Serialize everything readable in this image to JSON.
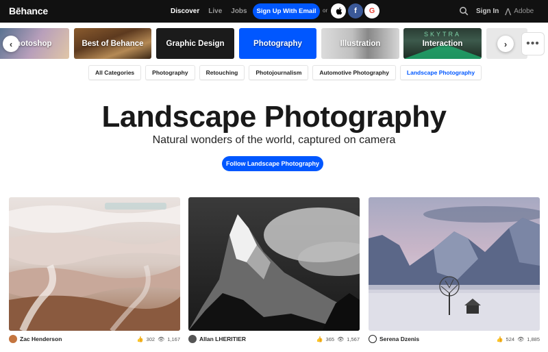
{
  "nav": {
    "logo": "Bēhance",
    "links": [
      "Discover",
      "Live",
      "Jobs"
    ],
    "signup_label": "Sign Up With Email",
    "or_label": "or",
    "social": [
      "apple",
      "f",
      "G"
    ],
    "signin_label": "Sign In",
    "adobe_label": "Adobe"
  },
  "categories": [
    "Photoshop",
    "Best of Behance",
    "Graphic Design",
    "Photography",
    "Illustration",
    "Interaction"
  ],
  "interaction_brand": "SKYTRA",
  "filters": [
    "All Categories",
    "Photography",
    "Retouching",
    "Photojournalism",
    "Automotive Photography",
    "Landscape Photography"
  ],
  "active_filter": "Landscape Photography",
  "hero": {
    "title": "Landscape Photography",
    "subtitle": "Natural wonders of the world, captured on camera",
    "follow_label": "Follow Landscape Photography"
  },
  "projects": [
    {
      "owner": "Zac Henderson",
      "appreciations": "302",
      "views": "1,167"
    },
    {
      "owner": "Allan LHERITIER",
      "appreciations": "365",
      "views": "1,567"
    },
    {
      "owner": "Serena Dzenis",
      "appreciations": "524",
      "views": "1,885"
    }
  ],
  "colors": {
    "accent": "#0057ff",
    "nav_bg": "#111111"
  }
}
